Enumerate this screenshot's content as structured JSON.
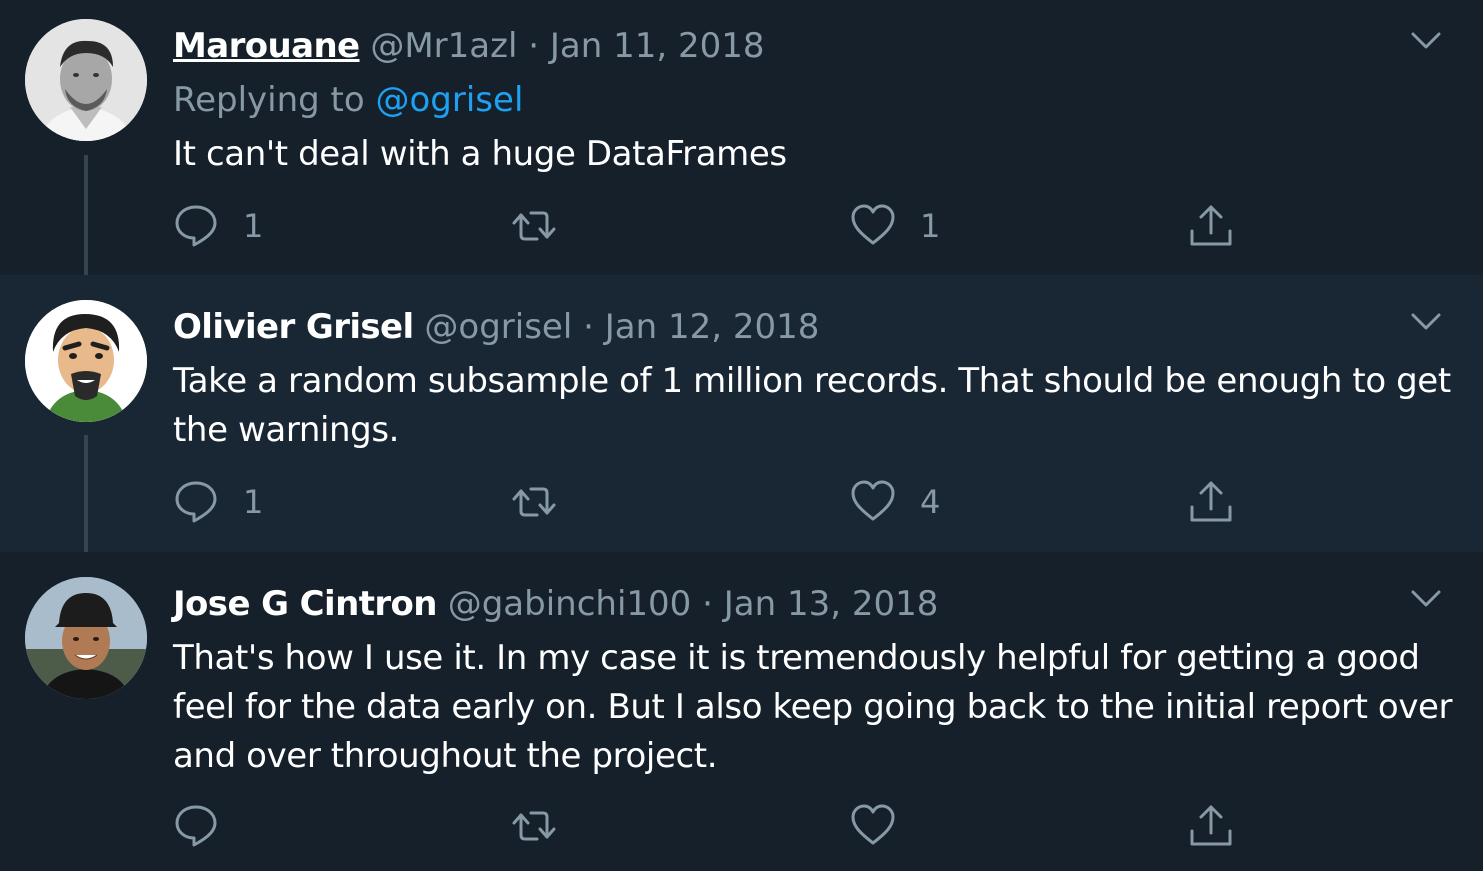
{
  "tweets": [
    {
      "name": "Marouane",
      "handle": "@Mr1azl",
      "dot": "·",
      "date": "Jan 11, 2018",
      "replying_prefix": "Replying to",
      "replying_to": "@ogrisel",
      "text": "It can't deal with a huge DataFrames",
      "replies": "1",
      "retweets": "",
      "likes": "1"
    },
    {
      "name": "Olivier Grisel",
      "handle": "@ogrisel",
      "dot": "·",
      "date": "Jan 12, 2018",
      "text": "Take a random subsample of 1 million records. That should be enough to get the warnings.",
      "replies": "1",
      "retweets": "",
      "likes": "4"
    },
    {
      "name": "Jose G Cintron",
      "handle": "@gabinchi100",
      "dot": "·",
      "date": "Jan 13, 2018",
      "text": "That's how I use it. In my case it is tremendously helpful for getting a good feel for the data early on. But I also keep going back to the initial report over and over throughout the project.",
      "replies": "",
      "retweets": "",
      "likes": ""
    }
  ],
  "icons": {
    "reply": "reply-icon",
    "retweet": "retweet-icon",
    "like": "heart-icon",
    "share": "share-icon",
    "caret": "chevron-down-icon"
  },
  "colors": {
    "background": "#15202b",
    "hover_background": "#192734",
    "secondary_text": "#8899a6",
    "link": "#1da1f2",
    "thread_line": "#38444d"
  }
}
